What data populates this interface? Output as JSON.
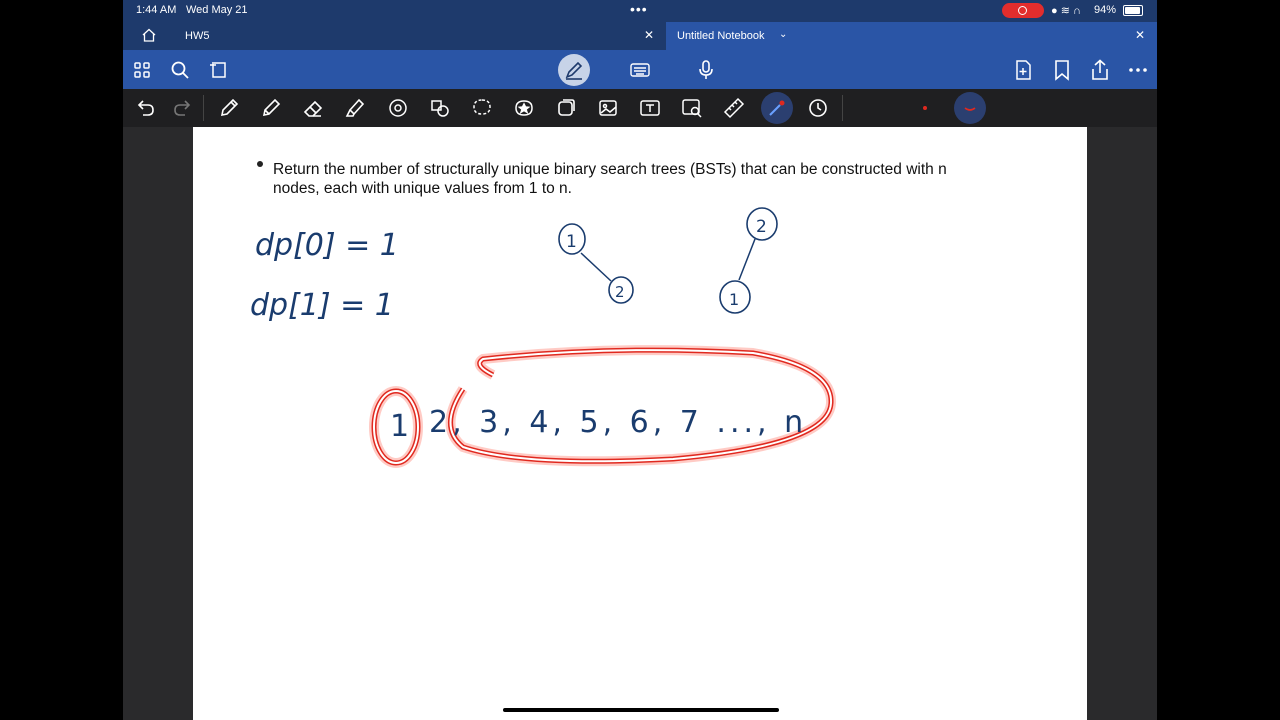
{
  "status_bar": {
    "time": "1:44 AM",
    "date": "Wed May 21",
    "battery": "94%"
  },
  "tabs": [
    {
      "label": "HW5"
    },
    {
      "label": "Untitled Notebook"
    }
  ],
  "colors": {
    "header_dark": "#1e3a6c",
    "header_blue": "#2a55a6",
    "ink_blue": "#1a3c6e",
    "highlight_red": "#e0291f"
  },
  "page": {
    "problem_text": "Return the number of structurally unique binary search trees (BSTs) that can be constructed with n nodes, each with unique values from 1 to n.",
    "handwriting": {
      "dp0": "dp[0] = 1",
      "dp1": "dp[1] = 1",
      "tree1_root": "1",
      "tree1_child": "2",
      "tree2_root": "2",
      "tree2_child": "1",
      "sequence_first": "1",
      "sequence_rest": "2, 3, 4, 5, 6, 7 ..., n"
    }
  },
  "icons": {
    "toolbar1_left": [
      "grid-icon",
      "search-icon",
      "lasso-bookmark-icon"
    ],
    "toolbar1_center": [
      "pen-mode-icon",
      "keyboard-icon",
      "microphone-icon"
    ],
    "toolbar1_right": [
      "add-page-icon",
      "bookmark-icon",
      "share-icon",
      "more-icon"
    ],
    "toolbar2": [
      "undo-icon",
      "redo-icon",
      "pen-icon",
      "pencil-icon",
      "eraser-icon",
      "highlighter-icon",
      "shapes-icon",
      "eraser-shape-icon",
      "lasso-icon",
      "sticker-icon",
      "element-icon",
      "image-icon",
      "textbox-icon",
      "image-search-icon",
      "ruler-icon",
      "laser-pointer-icon",
      "timer-icon"
    ]
  }
}
